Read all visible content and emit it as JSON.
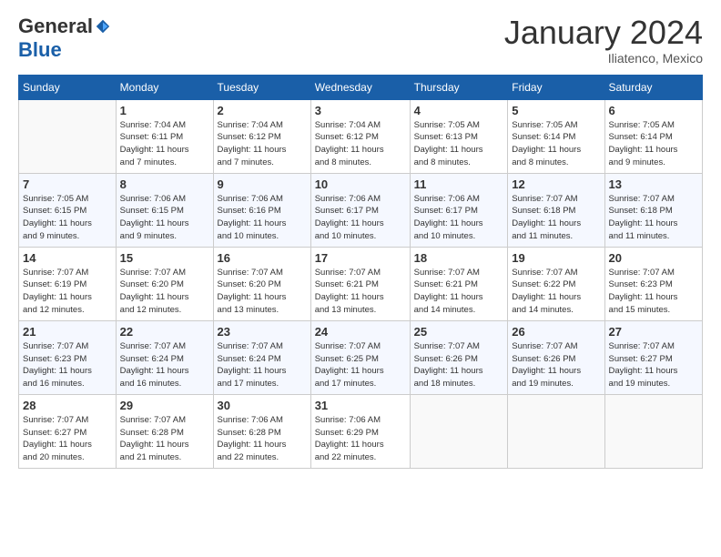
{
  "header": {
    "logo_general": "General",
    "logo_blue": "Blue",
    "month_title": "January 2024",
    "location": "Iliatenco, Mexico"
  },
  "days_of_week": [
    "Sunday",
    "Monday",
    "Tuesday",
    "Wednesday",
    "Thursday",
    "Friday",
    "Saturday"
  ],
  "weeks": [
    [
      {
        "num": "",
        "info": ""
      },
      {
        "num": "1",
        "info": "Sunrise: 7:04 AM\nSunset: 6:11 PM\nDaylight: 11 hours\nand 7 minutes."
      },
      {
        "num": "2",
        "info": "Sunrise: 7:04 AM\nSunset: 6:12 PM\nDaylight: 11 hours\nand 7 minutes."
      },
      {
        "num": "3",
        "info": "Sunrise: 7:04 AM\nSunset: 6:12 PM\nDaylight: 11 hours\nand 8 minutes."
      },
      {
        "num": "4",
        "info": "Sunrise: 7:05 AM\nSunset: 6:13 PM\nDaylight: 11 hours\nand 8 minutes."
      },
      {
        "num": "5",
        "info": "Sunrise: 7:05 AM\nSunset: 6:14 PM\nDaylight: 11 hours\nand 8 minutes."
      },
      {
        "num": "6",
        "info": "Sunrise: 7:05 AM\nSunset: 6:14 PM\nDaylight: 11 hours\nand 9 minutes."
      }
    ],
    [
      {
        "num": "7",
        "info": "Sunrise: 7:05 AM\nSunset: 6:15 PM\nDaylight: 11 hours\nand 9 minutes."
      },
      {
        "num": "8",
        "info": "Sunrise: 7:06 AM\nSunset: 6:15 PM\nDaylight: 11 hours\nand 9 minutes."
      },
      {
        "num": "9",
        "info": "Sunrise: 7:06 AM\nSunset: 6:16 PM\nDaylight: 11 hours\nand 10 minutes."
      },
      {
        "num": "10",
        "info": "Sunrise: 7:06 AM\nSunset: 6:17 PM\nDaylight: 11 hours\nand 10 minutes."
      },
      {
        "num": "11",
        "info": "Sunrise: 7:06 AM\nSunset: 6:17 PM\nDaylight: 11 hours\nand 10 minutes."
      },
      {
        "num": "12",
        "info": "Sunrise: 7:07 AM\nSunset: 6:18 PM\nDaylight: 11 hours\nand 11 minutes."
      },
      {
        "num": "13",
        "info": "Sunrise: 7:07 AM\nSunset: 6:18 PM\nDaylight: 11 hours\nand 11 minutes."
      }
    ],
    [
      {
        "num": "14",
        "info": "Sunrise: 7:07 AM\nSunset: 6:19 PM\nDaylight: 11 hours\nand 12 minutes."
      },
      {
        "num": "15",
        "info": "Sunrise: 7:07 AM\nSunset: 6:20 PM\nDaylight: 11 hours\nand 12 minutes."
      },
      {
        "num": "16",
        "info": "Sunrise: 7:07 AM\nSunset: 6:20 PM\nDaylight: 11 hours\nand 13 minutes."
      },
      {
        "num": "17",
        "info": "Sunrise: 7:07 AM\nSunset: 6:21 PM\nDaylight: 11 hours\nand 13 minutes."
      },
      {
        "num": "18",
        "info": "Sunrise: 7:07 AM\nSunset: 6:21 PM\nDaylight: 11 hours\nand 14 minutes."
      },
      {
        "num": "19",
        "info": "Sunrise: 7:07 AM\nSunset: 6:22 PM\nDaylight: 11 hours\nand 14 minutes."
      },
      {
        "num": "20",
        "info": "Sunrise: 7:07 AM\nSunset: 6:23 PM\nDaylight: 11 hours\nand 15 minutes."
      }
    ],
    [
      {
        "num": "21",
        "info": "Sunrise: 7:07 AM\nSunset: 6:23 PM\nDaylight: 11 hours\nand 16 minutes."
      },
      {
        "num": "22",
        "info": "Sunrise: 7:07 AM\nSunset: 6:24 PM\nDaylight: 11 hours\nand 16 minutes."
      },
      {
        "num": "23",
        "info": "Sunrise: 7:07 AM\nSunset: 6:24 PM\nDaylight: 11 hours\nand 17 minutes."
      },
      {
        "num": "24",
        "info": "Sunrise: 7:07 AM\nSunset: 6:25 PM\nDaylight: 11 hours\nand 17 minutes."
      },
      {
        "num": "25",
        "info": "Sunrise: 7:07 AM\nSunset: 6:26 PM\nDaylight: 11 hours\nand 18 minutes."
      },
      {
        "num": "26",
        "info": "Sunrise: 7:07 AM\nSunset: 6:26 PM\nDaylight: 11 hours\nand 19 minutes."
      },
      {
        "num": "27",
        "info": "Sunrise: 7:07 AM\nSunset: 6:27 PM\nDaylight: 11 hours\nand 19 minutes."
      }
    ],
    [
      {
        "num": "28",
        "info": "Sunrise: 7:07 AM\nSunset: 6:27 PM\nDaylight: 11 hours\nand 20 minutes."
      },
      {
        "num": "29",
        "info": "Sunrise: 7:07 AM\nSunset: 6:28 PM\nDaylight: 11 hours\nand 21 minutes."
      },
      {
        "num": "30",
        "info": "Sunrise: 7:06 AM\nSunset: 6:28 PM\nDaylight: 11 hours\nand 22 minutes."
      },
      {
        "num": "31",
        "info": "Sunrise: 7:06 AM\nSunset: 6:29 PM\nDaylight: 11 hours\nand 22 minutes."
      },
      {
        "num": "",
        "info": ""
      },
      {
        "num": "",
        "info": ""
      },
      {
        "num": "",
        "info": ""
      }
    ]
  ]
}
